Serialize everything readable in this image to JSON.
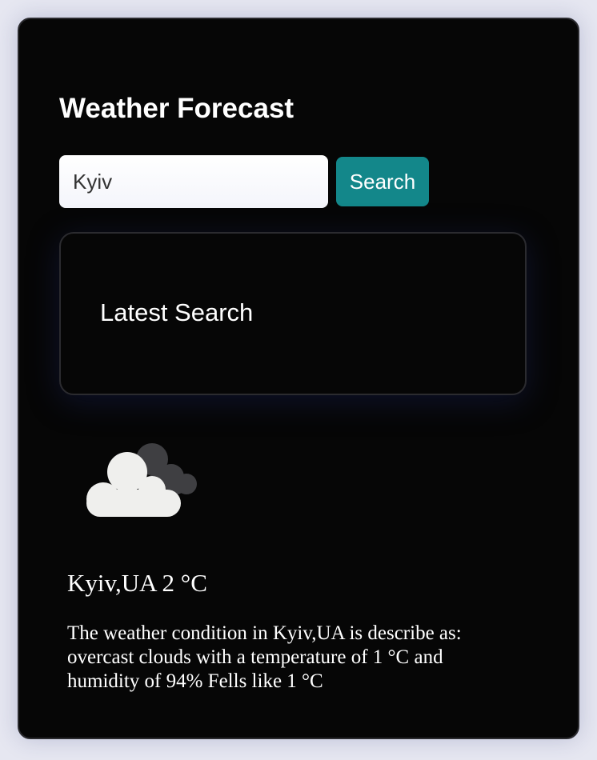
{
  "app": {
    "title": "Weather Forecast"
  },
  "search": {
    "value": "Kyiv",
    "button_label": "Search"
  },
  "latest": {
    "label": "Latest Search"
  },
  "weather": {
    "icon": "overcast-clouds-icon",
    "city_temp": "Kyiv,UA 2 °C",
    "description": "The weather condition in Kyiv,UA is describe as: overcast clouds with a temperature of 1 °C and humidity of 94% Fells like 1 °C"
  },
  "colors": {
    "background": "#e6e7f1",
    "card": "#060606",
    "accent": "#13878a",
    "text": "#ffffff"
  }
}
